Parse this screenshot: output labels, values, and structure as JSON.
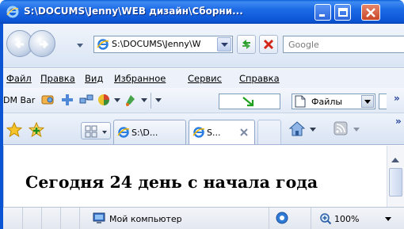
{
  "window": {
    "title": "S:\\DOCUMS\\Jenny\\WEB дизайн\\Сборни..."
  },
  "address_bar": {
    "url": "S:\\DOCUMS\\Jenny\\W",
    "search_placeholder": "Google"
  },
  "menu": {
    "items": [
      "Файл",
      "Правка",
      "Вид",
      "Избранное",
      "Сервис",
      "Справка"
    ]
  },
  "dm_toolbar": {
    "label": "DM Bar",
    "files_label": "Файлы"
  },
  "tabs": [
    {
      "label": "S:\\D...",
      "active": false
    },
    {
      "label": "S...",
      "active": true
    }
  ],
  "content": {
    "heading": "Сегодня 24 день с начала года"
  },
  "status": {
    "zone": "Мой компьютер",
    "zoom": "100%"
  },
  "colors": {
    "titlebar": "#0b55d4",
    "frame": "#0b55d4",
    "close_button": "#c94628"
  },
  "icons": {
    "app": "ie-icon",
    "back": "back-arrow-icon",
    "forward": "forward-arrow-icon",
    "refresh": "refresh-icon",
    "stop": "stop-icon",
    "favorites": "favorites-star-icon",
    "add_favorites": "add-favorites-icon",
    "home": "home-icon",
    "feeds": "rss-feed-icon",
    "zone": "computer-icon",
    "zoom": "magnifier-icon"
  }
}
